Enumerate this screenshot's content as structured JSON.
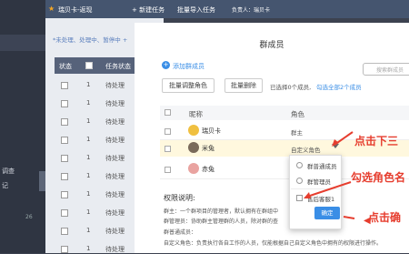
{
  "topbar": {
    "title": "瑞贝卡-返现",
    "new_task": "+ 新建任务",
    "batch_import": "批量导入任务",
    "owner": "负责人：瑞贝卡"
  },
  "sidebar": {
    "items": [
      "调查",
      "记"
    ],
    "badge": "26"
  },
  "list": {
    "filter_text": "*未处理、处理中、暂停中 +",
    "headers": [
      "状态",
      "任务状态"
    ],
    "rows": [
      {
        "n": "1",
        "s": "待处理"
      },
      {
        "n": "1",
        "s": "待处理"
      },
      {
        "n": "1",
        "s": "待处理"
      },
      {
        "n": "1",
        "s": "待处理"
      },
      {
        "n": "1",
        "s": "待处理"
      },
      {
        "n": "1",
        "s": "待处理"
      },
      {
        "n": "1",
        "s": "待处理"
      },
      {
        "n": "1",
        "s": "待处理"
      },
      {
        "n": "1",
        "s": "待处理"
      },
      {
        "n": "1",
        "s": "待处理"
      }
    ]
  },
  "modal": {
    "title": "群成员",
    "add_member": "添加群成员",
    "search_placeholder": "搜索群成员",
    "btn_batch_role": "批量调整角色",
    "btn_batch_delete": "批量删除",
    "selected_info": "已选择0个成员,",
    "select_all": "勾选全部2个成员",
    "col_nickname": "昵称",
    "col_role": "角色",
    "members": [
      {
        "name": "瑞贝卡",
        "role": "群主"
      },
      {
        "name": "米兔",
        "role": "自定义角色"
      },
      {
        "name": "赤兔",
        "role": ""
      }
    ],
    "perm_title": "权限说明:",
    "perm_lines": [
      "群主：一个群项目的管理者，默认拥有在群组中",
      "群管理员：协助群主管理群的人员，除对群的查",
      "群普通成员：",
      "自定义角色：负责执行各自工作的人员，仅能根据自己自定义角色中拥有的权限进行操作。"
    ]
  },
  "dropdown": {
    "options": [
      "群普通成员",
      "群管理员"
    ],
    "custom_role": "售后客服1",
    "ok": "确定"
  },
  "callouts": {
    "c1": "点击下三",
    "c2": "勾选角色名",
    "c3": "点击确"
  }
}
